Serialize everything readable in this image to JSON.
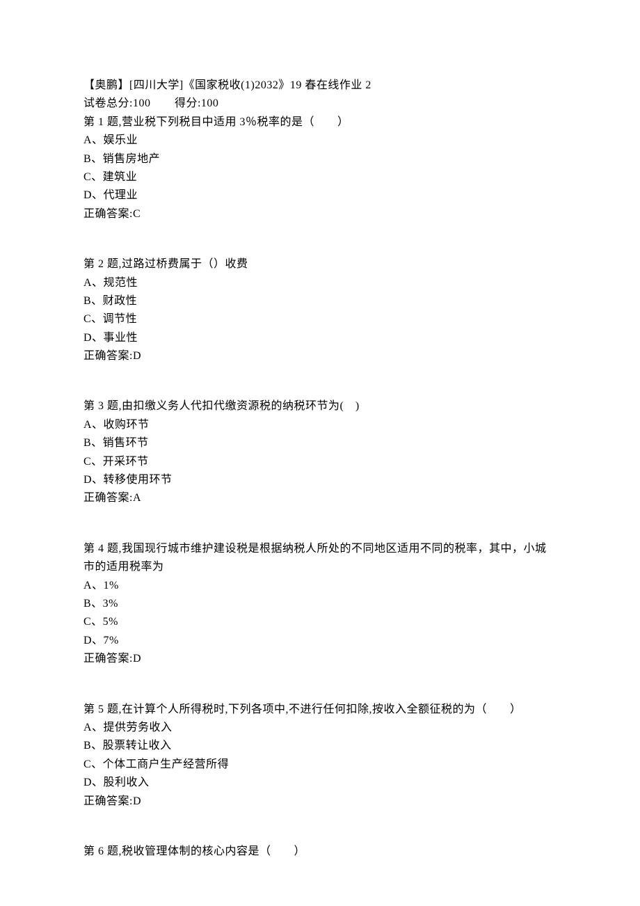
{
  "header": {
    "title": "【奥鹏】[四川大学]《国家税收(1)2032》19 春在线作业 2",
    "total_label": "试卷总分:100",
    "score_label": "得分:100"
  },
  "questions": [
    {
      "prompt": "第 1 题,营业税下列税目中适用 3％税率的是（　　）",
      "options": [
        "A、娱乐业",
        "B、销售房地产",
        "C、建筑业",
        "D、代理业"
      ],
      "answer": "正确答案:C"
    },
    {
      "prompt": "第 2 题,过路过桥费属于（）收费",
      "options": [
        "A、规范性",
        "B、财政性",
        "C、调节性",
        "D、事业性"
      ],
      "answer": "正确答案:D"
    },
    {
      "prompt": "第 3 题,由扣缴义务人代扣代缴资源税的纳税环节为(　)",
      "options": [
        "A、收购环节",
        "B、销售环节",
        "C、开采环节",
        "D、转移使用环节"
      ],
      "answer": "正确答案:A"
    },
    {
      "prompt": "第 4 题,我国现行城市维护建设税是根据纳税人所处的不同地区适用不同的税率，其中，小城市的适用税率为",
      "options": [
        "A、1%",
        "B、3%",
        "C、5%",
        "D、7%"
      ],
      "answer": "正确答案:D"
    },
    {
      "prompt": "第 5 题,在计算个人所得税时,下列各项中,不进行任何扣除,按收入全额征税的为（　　）",
      "options": [
        "A、提供劳务收入",
        "B、股票转让收入",
        "C、个体工商户生产经营所得",
        "D、股利收入"
      ],
      "answer": "正确答案:D"
    },
    {
      "prompt": "第 6 题,税收管理体制的核心内容是（　　）",
      "options": [],
      "answer": ""
    }
  ]
}
